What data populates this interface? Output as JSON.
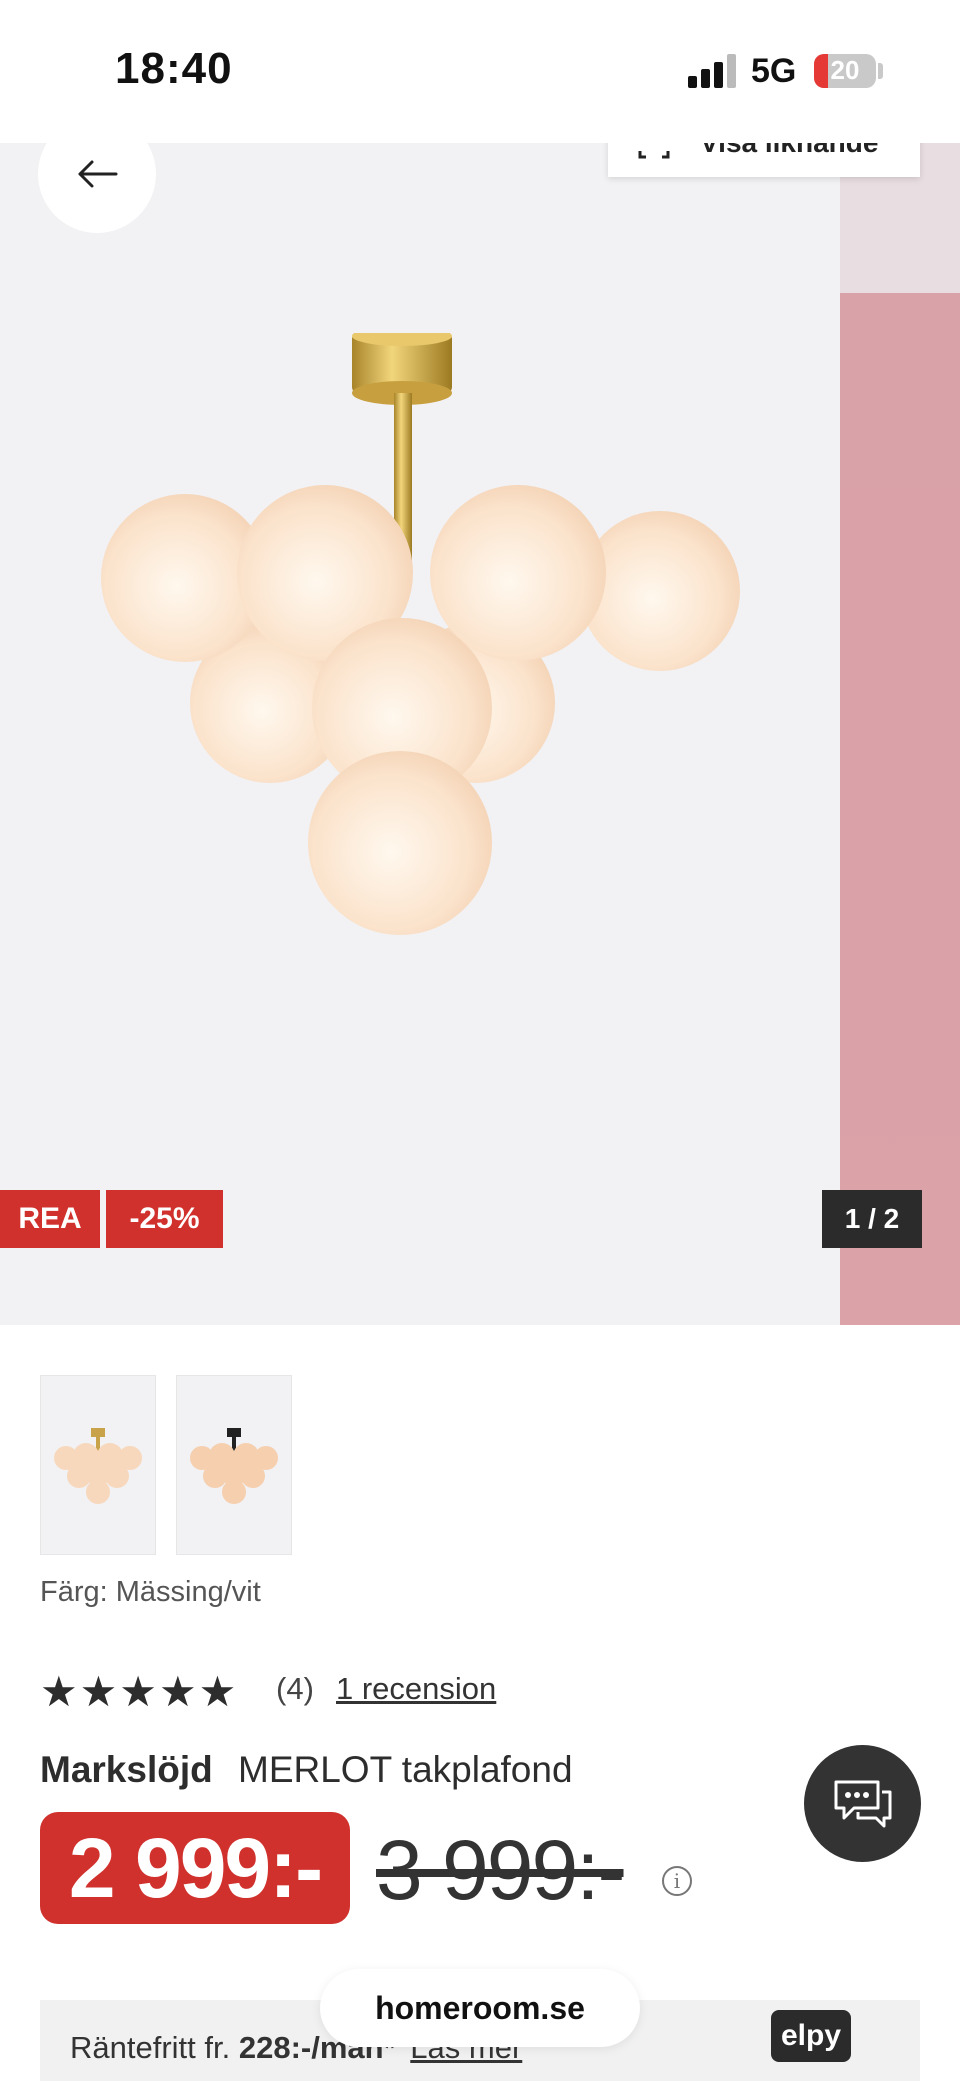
{
  "status_bar": {
    "time": "18:40",
    "network": "5G",
    "battery": "20"
  },
  "hero": {
    "similar_label": "Visa liknande",
    "badge_sale": "REA",
    "badge_discount": "-25%",
    "pager": "1 / 2"
  },
  "product": {
    "color_label": "Färg: Mässing/vit",
    "rating_stars": "★★★★★",
    "rating_count": "(4)",
    "reviews_link": "1 recension",
    "brand": "Markslöjd",
    "name": "MERLOT takplafond",
    "price": "2 999:-",
    "old_price": "3 999:-",
    "info_icon": "i"
  },
  "financing": {
    "prefix": "Räntefritt fr.",
    "amount": "228:-/man*",
    "link": "Läs mer",
    "provider": "elpy"
  },
  "browser": {
    "url": "homeroom.se"
  },
  "colors": {
    "sale_red": "#d0312d",
    "dark": "#2b2b2b"
  }
}
